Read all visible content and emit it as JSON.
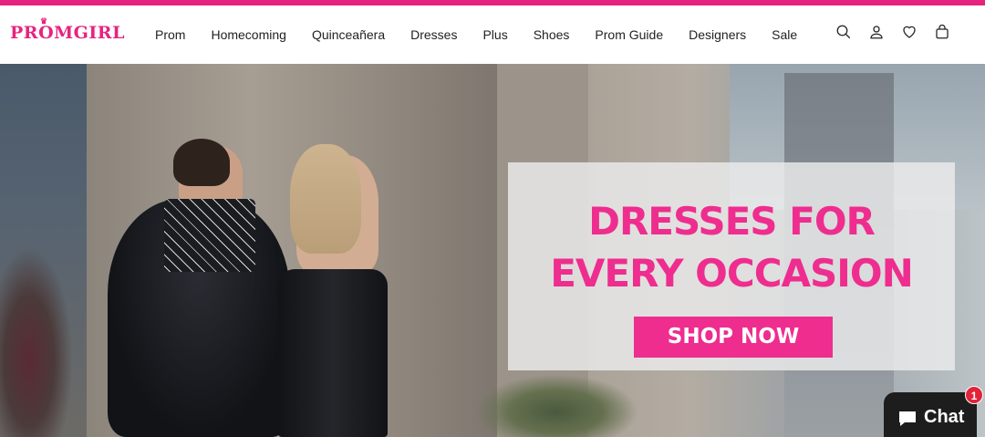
{
  "brand": {
    "name": "PROMGIRL",
    "color": "#e6247f"
  },
  "nav": {
    "items": [
      {
        "label": "Prom"
      },
      {
        "label": "Homecoming"
      },
      {
        "label": "Quinceañera"
      },
      {
        "label": "Dresses"
      },
      {
        "label": "Plus"
      },
      {
        "label": "Shoes"
      },
      {
        "label": "Prom Guide"
      },
      {
        "label": "Designers"
      },
      {
        "label": "Sale"
      }
    ]
  },
  "header_icons": [
    "search-icon",
    "account-icon",
    "wishlist-heart-icon",
    "cart-bag-icon"
  ],
  "hero": {
    "headline_line1": "DRESSES FOR",
    "headline_line2": "EVERY OCCASION",
    "cta_label": "SHOP NOW",
    "accent_color": "#ee2d8f"
  },
  "chat": {
    "label": "Chat",
    "badge_count": "1"
  }
}
